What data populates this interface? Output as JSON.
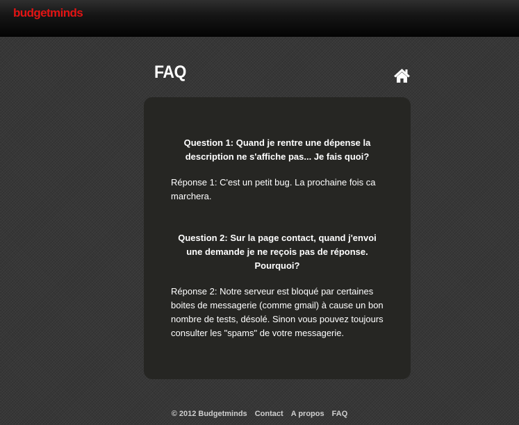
{
  "header": {
    "logo_text": "budgetminds",
    "logo_color": "#e21414"
  },
  "page": {
    "title": "FAQ",
    "home_icon": "home-icon"
  },
  "faq": [
    {
      "question": "Question 1: Quand je rentre une dépense la description ne s'affiche pas... Je fais quoi?",
      "answer": "Réponse 1: C'est un petit bug. La prochaine fois ca marchera."
    },
    {
      "question": "Question 2:  Sur la page contact, quand j'envoi une demande je ne reçois pas de réponse. Pourquoi?",
      "answer": "Réponse 2: Notre serveur est bloqué par certaines boites de messagerie (comme gmail) à cause un bon nombre de tests, désolé. Sinon vous pouvez toujours consulter les \"spams\" de votre messagerie."
    }
  ],
  "footer": {
    "copyright": "© 2012 Budgetminds",
    "links": [
      "Contact",
      "A propos",
      "FAQ"
    ]
  }
}
